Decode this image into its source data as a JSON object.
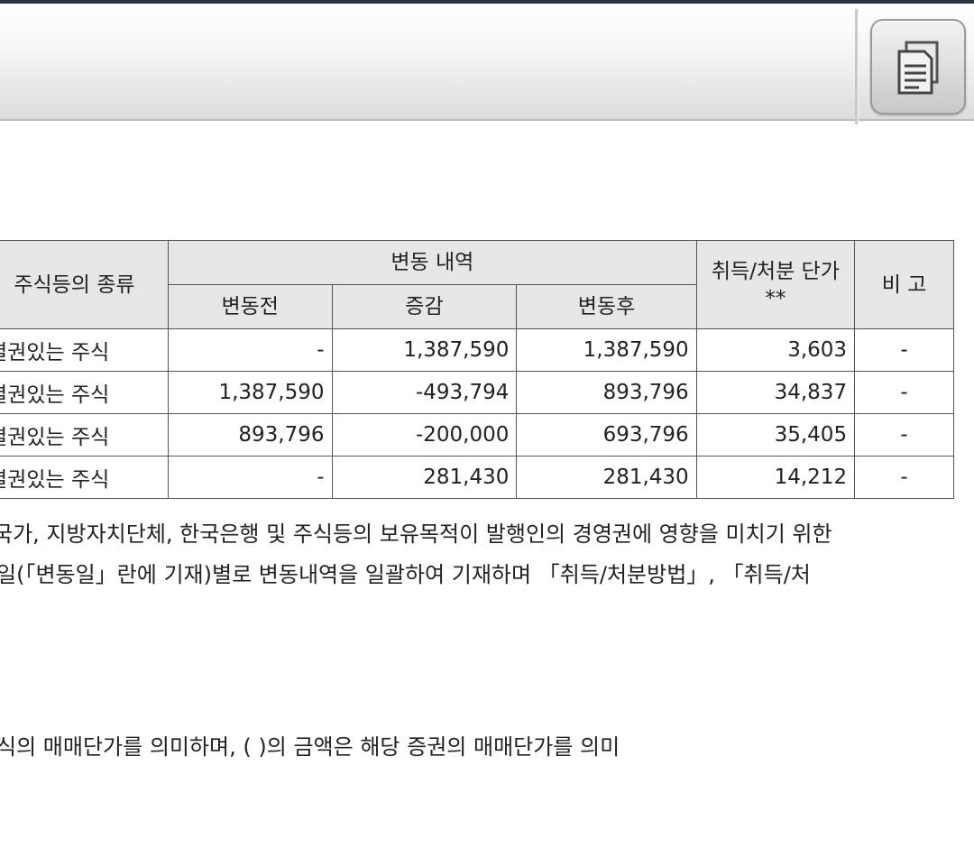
{
  "header": {
    "document_icon": "document-copy-icon"
  },
  "table": {
    "headers": {
      "kind": "주식등의 종류",
      "change_detail": "변동 내역",
      "before": "변동전",
      "change": "증감",
      "after": "변동후",
      "unit_price": "취득/처분 단가**",
      "remark": "비 고"
    },
    "rows": [
      {
        "kind": "결권있는 주식",
        "before": "-",
        "change": "1,387,590",
        "after": "1,387,590",
        "unit_price": "3,603",
        "remark": "-"
      },
      {
        "kind": "결권있는 주식",
        "before": "1,387,590",
        "change": "-493,794",
        "after": "893,796",
        "unit_price": "34,837",
        "remark": "-"
      },
      {
        "kind": "결권있는 주식",
        "before": "893,796",
        "change": "-200,000",
        "after": "693,796",
        "unit_price": "35,405",
        "remark": "-"
      },
      {
        "kind": "결권있는 주식",
        "before": "-",
        "change": "281,430",
        "after": "281,430",
        "unit_price": "14,212",
        "remark": "-"
      }
    ]
  },
  "notes": {
    "line1": "국가, 지방자치단체, 한국은행 및 주식등의 보유목적이 발행인의 경영권에 영향을 미치기 위한",
    "line2": "일(「변동일」란에 기재)별로 변동내역을 일괄하여 기재하며 「취득/처분방법」, 「취득/처",
    "line3": "식의 매매단가를 의미하며, (   )의 금액은 해당 증권의 매매단가를 의미"
  }
}
